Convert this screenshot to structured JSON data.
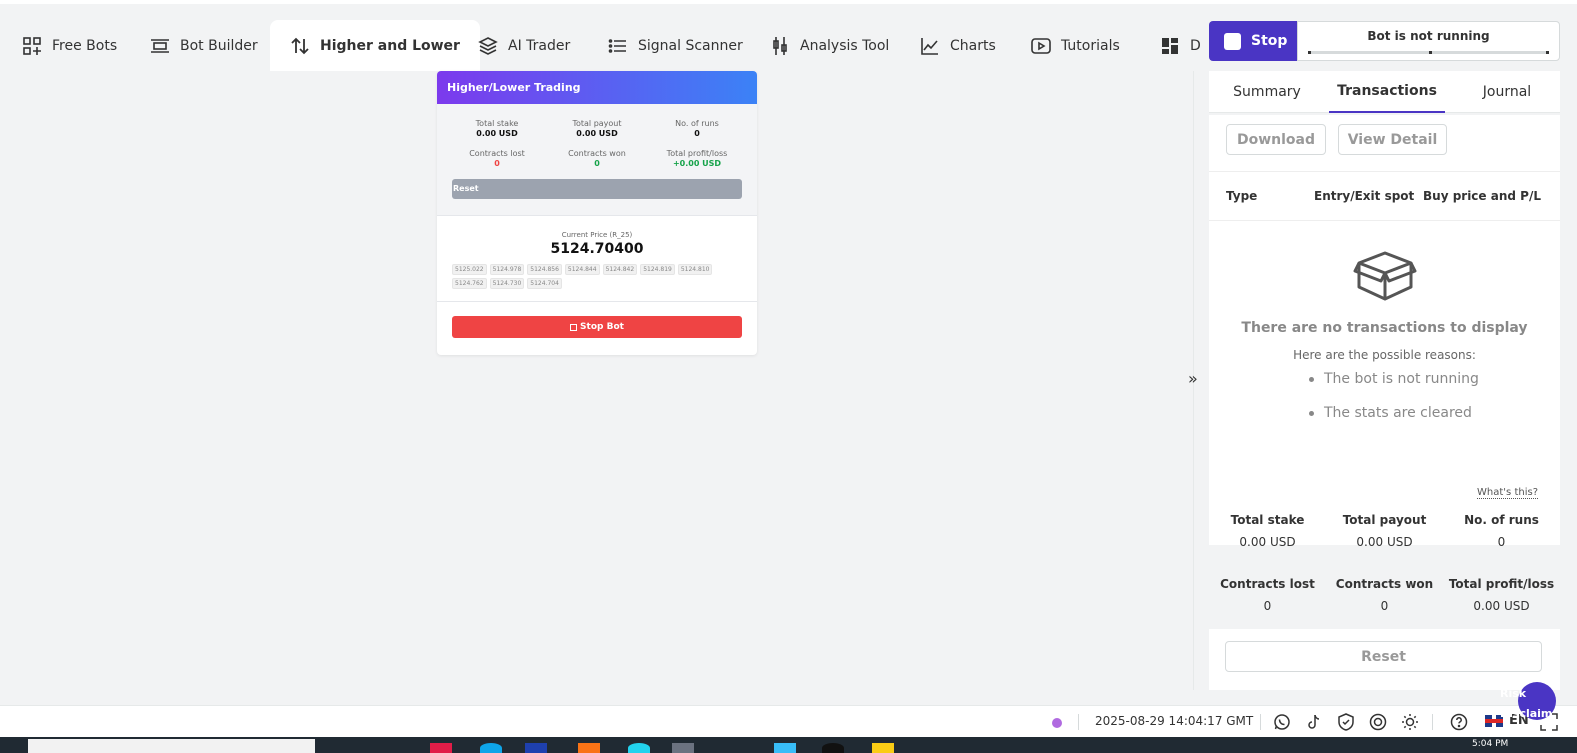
{
  "tabs": [
    {
      "label": "Free Bots",
      "icon": "grid-plus-icon"
    },
    {
      "label": "Bot Builder",
      "icon": "builder-icon"
    },
    {
      "label": "Higher and Lower",
      "icon": "up-down-arrows-icon",
      "active": true
    },
    {
      "label": "AI Trader",
      "icon": "layers-icon"
    },
    {
      "label": "Signal Scanner",
      "icon": "list-icon"
    },
    {
      "label": "Analysis Tool",
      "icon": "candles-icon"
    },
    {
      "label": "Charts",
      "icon": "line-chart-icon"
    },
    {
      "label": "Tutorials",
      "icon": "play-icon"
    },
    {
      "label": "Das",
      "icon": "dashboard-icon"
    }
  ],
  "run_panel": {
    "stop_label": "Stop",
    "status": "Bot is not running"
  },
  "right_panel": {
    "tabs": [
      "Summary",
      "Transactions",
      "Journal"
    ],
    "active_tab": "Transactions",
    "download_label": "Download",
    "view_detail_label": "View Detail",
    "columns": [
      "Type",
      "Entry/Exit spot",
      "Buy price and P/L"
    ],
    "empty_title": "There are no transactions to display",
    "empty_subtitle": "Here are the possible reasons:",
    "reasons": [
      "The bot is not running",
      "The stats are cleared"
    ],
    "whats_this": "What's this?",
    "stats": [
      {
        "label": "Total stake",
        "value": "0.00 USD"
      },
      {
        "label": "Total payout",
        "value": "0.00 USD"
      },
      {
        "label": "No. of runs",
        "value": "0"
      },
      {
        "label": "Contracts lost",
        "value": "0"
      },
      {
        "label": "Contracts won",
        "value": "0"
      },
      {
        "label": "Total profit/loss",
        "value": "0.00 USD"
      }
    ],
    "reset_label": "Reset"
  },
  "card": {
    "title": "Higher/Lower Trading",
    "stats": [
      {
        "label": "Total stake",
        "value": "0.00 USD"
      },
      {
        "label": "Total payout",
        "value": "0.00 USD"
      },
      {
        "label": "No. of runs",
        "value": "0"
      },
      {
        "label": "Contracts lost",
        "value": "0"
      },
      {
        "label": "Contracts won",
        "value": "0"
      },
      {
        "label": "Total profit/loss",
        "value": "+0.00 USD"
      }
    ],
    "reset_label": "Reset",
    "price_label": "Current Price (R_25)",
    "price": "5124.70400",
    "ticks": [
      "5125.022",
      "5124.978",
      "5124.856",
      "5124.844",
      "5124.842",
      "5124.819",
      "5124.810",
      "5124.762",
      "5124.730",
      "5124.704"
    ],
    "stop_label": "Stop Bot",
    "colors": {
      "gradient_start": "#7c3aed",
      "gradient_end": "#3b82f6",
      "stop": "#ef4444",
      "lost": "#ef4444",
      "won": "#16a34a"
    }
  },
  "footer": {
    "timestamp": "2025-08-29 14:04:17 GMT",
    "language": "EN",
    "icons": [
      "whatsapp-icon",
      "tiktok-icon",
      "shield-check-icon",
      "responsible-trading-icon",
      "theme-icon",
      "help-icon",
      "fullscreen-icon"
    ]
  },
  "risk_label": "Risk\nDisclaim",
  "taskbar": {
    "time": "5:04 PM"
  },
  "colors": {
    "accent": "#4a35c4",
    "status_dot": "#b06ae0"
  }
}
